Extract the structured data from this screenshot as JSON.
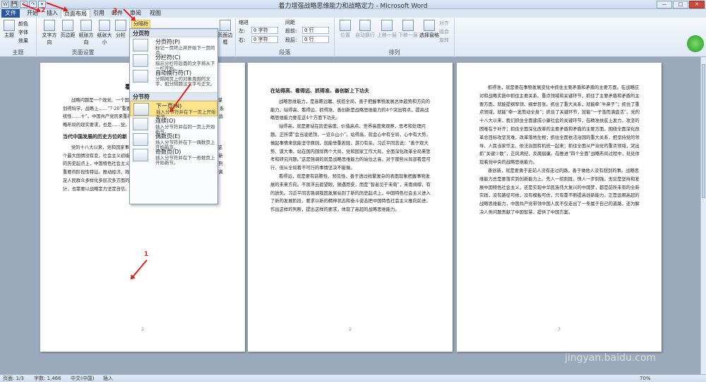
{
  "window": {
    "title": "着力增强战略思维能力和战略定力 - Microsoft Word"
  },
  "qat": [
    "W",
    "💾",
    "↶",
    "↷",
    "▾"
  ],
  "winctl": {
    "min": "—",
    "max": "□",
    "close": "✕"
  },
  "tabs": {
    "file": "文件",
    "items": [
      "开始",
      "插入",
      "页面布局",
      "引用",
      "邮件",
      "审阅",
      "视图"
    ]
  },
  "ribbon": {
    "theme": {
      "label": "主题",
      "colors": "颜色",
      "fonts": "字体",
      "effects": "效果",
      "group": "主题"
    },
    "page_setup": {
      "buttons": [
        "文字方向",
        "页边距",
        "纸张方向",
        "纸张大小",
        "分栏"
      ],
      "breaks": "分隔符",
      "group": "页面设置"
    },
    "page_bg": {
      "border": "页面边框"
    },
    "paragraph": {
      "indent": "缩进",
      "left": "左:",
      "left_val": "0 字符",
      "right": "右:",
      "right_val": "0 字符",
      "spacing": "间距",
      "before": "段前:",
      "before_val": "0 行",
      "after": "段后:",
      "after_val": "0 行",
      "group": "段落"
    },
    "arrange": {
      "buttons": [
        "位置",
        "自动换行",
        "上移一层",
        "下移一层",
        "选择窗格"
      ],
      "align": "对齐",
      "group_btn": "组合",
      "rotate": "旋转",
      "group": "排列"
    }
  },
  "dropdown": {
    "section1": "分页符",
    "items1": [
      {
        "title": "分页符(P)",
        "desc": "标记一页终止并开始下一页的点。"
      },
      {
        "title": "分栏符(C)",
        "desc": "指示分栏符后面的文字将从下一栏开始。"
      },
      {
        "title": "自动换行符(T)",
        "desc": "分隔网页上的对象周围的文字，如分隔题注文字与正文。"
      }
    ],
    "section2": "分节符",
    "items2": [
      {
        "title": "下一页(N)",
        "desc": "插入分节符并在下一页上开始新节。"
      },
      {
        "title": "连续(O)",
        "desc": "插入分节符并在同一页上开始新节。"
      },
      {
        "title": "偶数页(E)",
        "desc": "插入分节符并在下一偶数页上开始新节。"
      },
      {
        "title": "奇数页(D)",
        "desc": "插入分节符并在下一奇数页上开始新节。"
      }
    ]
  },
  "page1": {
    "title": "着力增强战略",
    "p1": "战略问题是一个政党、一个国家的根本性问题。战略上判断得准确，战略上谋划得科学，战略上……“7·26”重要讲话中，习近平同志……增强工作的原则性、系统性……十”。中国共产党历来重视战略……强战略定力。这既是总结新……面”战略布局的现实要求，也是……觉。",
    "heading": "当代中国发展的历史方位的新",
    "p2": "党的十八大以来，党和国家事业发生了历史性变革。尽管社会主义初级阶段这个最大国情没有变，社会主义初级阶段这个最大实际不能忘，但我国发展站到了新的历史起点上，中国特色社会主义进入了新的发展阶段，我国社会发展呈现一系列重要的阶段性特征。推动经济、政治、文化、社会、生态文明建设和党的建设，满足人民群众多样化多层次多方面的需求，需要以高超的战略思维能力进行顶层设计，也需要以战略定力坚定自信、站稳脚跟。"
  },
  "page2": {
    "heading": "在站得高、看得远、抓得准、善创新上下功夫",
    "p1": "战略思维能力，是高瞻远瞩、统揽全局，善于把握事物发展总体趋势和方向的能力。站得高、看得远、抓得准、善创新是战略思维能力的4个突出特点，提高战略思维能力要在这4个方面下功夫。",
    "p2": "站得高，就是要站在历史高度、价值高点、世界高度来观察，思考和处理问题。正所谓“会当凌绝顶，一览众山小”。站得高，就会心中有全局，心中有大势，做起事情来就能坚守原则，就能举重若轻，游刃有余。习近平同志说：“善于观大势、谋大事，站在国内国际两个大局，党和国家工作大局，全面深化改革全局来思考和研究问题。”这是强调的就是战略思维能力的站位之高，对于那些从局部看是可行，但从全局看不可行的事情坚决不能做。",
    "p3": "看得远，就是要有前瞻性、预见性，善于透过纷繁复杂的表面现象把握事物发展的未来方向。不畏浮云遮望眼，随遇而安，而是“智者见于未萌”，未雨绸缪，有的放矢。习近平同志强调我国发展站到了新的历史起点上，中国特色社会主义进入了新的发展阶段，要求以新的精神状态和奋斗姿态把中国特色社会主义推向前进，作出这样的判断，提出这样的要求，体现了高超的战略思维能力。"
  },
  "page3": {
    "p1": "抓得准，就是要在事物发展变化中抓住主要矛盾和矛盾的主要方面。在战略应对和战略实施中抓住主要关系、重点领域和关键环节，抓住了主要矛盾和矛盾的主要方面，就能提纲挈领、纲举目张。抓住了重大关系，就能牵“牛鼻子”；抓住了重点领域，就能“牵一发而动全身”；抓住了关键环节，就能“一子落而满盘活”。党的十八大以来，我们抓住全面建成小康社会的关键环节，在精准扶贫上发力，攻坚的困难在于补齐；抓住全面深化改革的主要矛盾和矛盾的主要方面，围绕全面深化改革总目标攻坚克难，改革落地生根；抓住全面依法治国的重大关系，把坚持党的领导、人民当家作主、依法治国有机统一起来；抓住全面从严治党的重点领域，突出抓“关键少数”，正风肃纪，反腐倡廉。在推进“四个全面”战略布局过程中，处处体现着党中央的战略思维能力。",
    "p2": "善创新，就是要勇于走前人没有走过的路，善于做他人没有想到的事。战略思维能力总是要落实到创新能力上。先人一招则胜，快人一步则强。无论是坚持和发展中国特色社会主义，还是实现中华民族伟大复兴的中国梦，都是前所未有的全新实践，没有路径可依，没有模板可仿，只有靠不断提高创新能力。正是运用高超的战略思维能力，中国共产党带领中国人民不仅走出了一条属于自己的道路，还为解决人类问题贡献了中国智慧、提供了中国方案。"
  },
  "page_nums": [
    "1",
    "2",
    "3"
  ],
  "status": {
    "page": "页面: 1/3",
    "words": "字数: 1,466",
    "lang": "中文(中国)",
    "mode": "插入",
    "zoom": "70%"
  },
  "annotations": [
    "1",
    "2",
    "3"
  ],
  "badge": "",
  "watermark": {
    "logo": "Baidu 经验",
    "url": "jingyan.baidu.com"
  }
}
